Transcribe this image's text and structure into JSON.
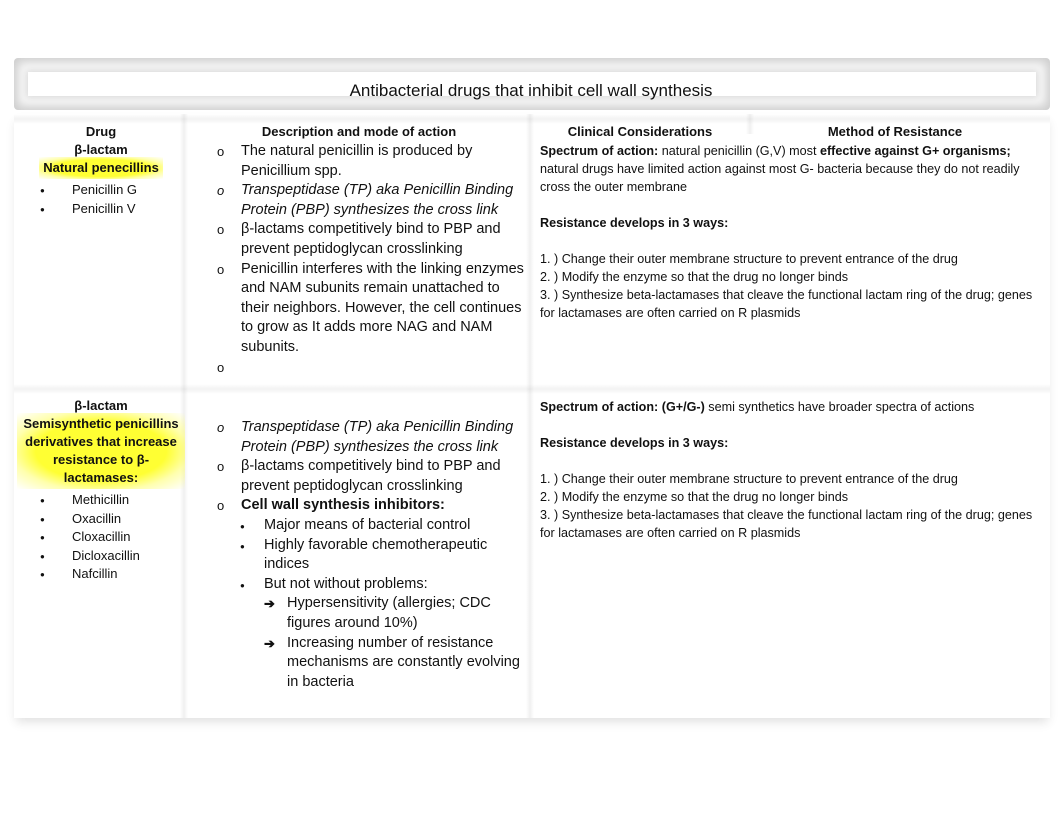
{
  "document": {
    "title": "Antibacterial drugs that inhibit cell wall synthesis",
    "headers": {
      "drug": "Drug",
      "description": "Description and mode of action",
      "clinical": "Clinical Considerations",
      "resistance": "Method of Resistance"
    },
    "rows": [
      {
        "drug_class": "β-lactam",
        "drug_group": "Natural penecillins",
        "drugs": [
          "Penicillin G",
          "Penicillin V"
        ],
        "description": [
          {
            "text": "The natural penicillin is produced by Penicillium spp.",
            "style": "normal"
          },
          {
            "text": "Transpeptidase (TP) aka Penicillin Binding Protein (PBP) synthesizes the cross link",
            "style": "italic"
          },
          {
            "text": "β-lactams competitively bind to PBP and prevent peptidoglycan crosslinking",
            "style": "normal"
          },
          {
            "text": "Penicillin interferes with the linking enzymes and NAM subunits remain unattached to their neighbors. However, the cell continues to grow as It adds more NAG and NAM subunits.",
            "style": "normal"
          },
          {
            "text": "",
            "style": "normal"
          }
        ],
        "spectrum_label": "Spectrum of action:",
        "spectrum_text_1": " natural penicillin (G,V) most ",
        "spectrum_bold": "effective against G+ organisms;",
        "spectrum_text_2": " natural drugs have limited action against most G- bacteria because they do not readily cross the outer membrane",
        "resistance_heading": "Resistance develops in 3 ways:",
        "resistance_items": [
          "1. ) Change their outer membrane structure to prevent entrance of the drug",
          "2. ) Modify the enzyme so that the drug no longer binds",
          "3. ) Synthesize beta-lactamases that cleave the functional lactam ring of the drug; genes for lactamases are often carried on R plasmids"
        ]
      },
      {
        "drug_class": "β-lactam",
        "drug_group": "Semisynthetic penicillins derivatives that increase resistance to  β-lactamases:",
        "drugs": [
          "Methicillin",
          "Oxacillin",
          "Cloxacillin",
          "Dicloxacillin",
          "Nafcillin"
        ],
        "description": [
          {
            "text": "Transpeptidase (TP) aka Penicillin Binding Protein (PBP) synthesizes the cross link",
            "style": "italic"
          },
          {
            "text": "β-lactams competitively bind to PBP and prevent peptidoglycan crosslinking",
            "style": "normal"
          },
          {
            "text": "Cell wall synthesis inhibitors:",
            "style": "bold"
          }
        ],
        "inhibitor_points": [
          "Major means of bacterial control",
          "Highly favorable chemotherapeutic indices",
          "But not without problems:"
        ],
        "problems": [
          "Hypersensitivity (allergies; CDC figures around 10%)",
          "Increasing number of resistance mechanisms are constantly evolving in bacteria"
        ],
        "spectrum_label": "Spectrum of action:",
        "spectrum_bold": " (G+/G-)",
        "spectrum_text_1": " semi synthetics have broader spectra of actions",
        "resistance_heading": "Resistance develops in 3 ways:",
        "resistance_items": [
          "1. ) Change their outer membrane structure to prevent entrance of the drug",
          "2. ) Modify the enzyme so that the drug no longer binds",
          "3. ) Synthesize beta-lactamases that cleave the functional lactam ring of the drug; genes for lactamases are often carried on R plasmids"
        ]
      }
    ]
  },
  "icons": {
    "bullet": "filled-circle-bullet-icon",
    "hollow_bullet": "hollow-circle-bullet-icon",
    "arrow": "right-arrow-icon"
  }
}
